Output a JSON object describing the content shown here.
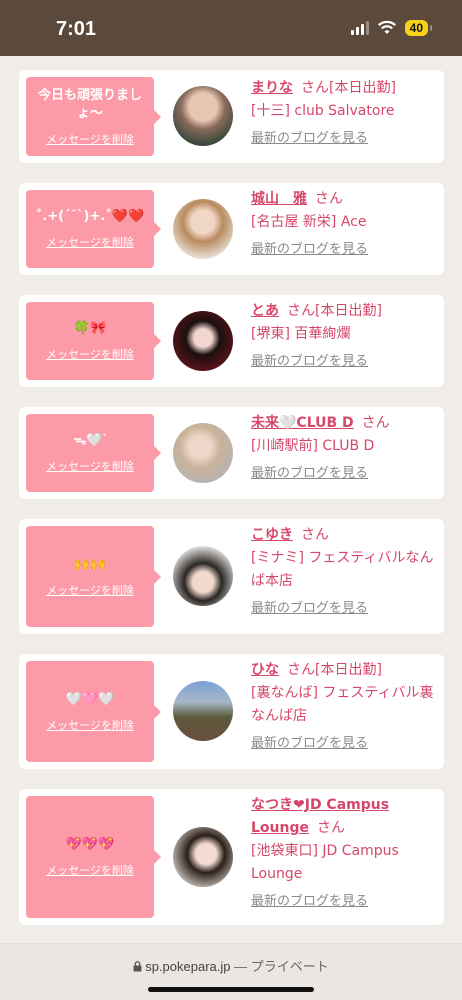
{
  "status": {
    "time": "7:01",
    "battery": "40"
  },
  "cards": [
    {
      "message": "今日も頑張りましょ〜",
      "delete_label": "メッセージを削除",
      "name": "まりな",
      "san": "さん",
      "tag": "[本日出勤]",
      "shop": "[十三] club Salvatore",
      "blog": "最新のブログを見る"
    },
    {
      "message": "˚.+(´˘`)+.˚❤️❤️",
      "delete_label": "メッセージを削除",
      "name": "城山　雅",
      "san": "さん",
      "tag": "",
      "shop": "[名古屋 新栄] Ace",
      "blog": "最新のブログを見る"
    },
    {
      "message": "🍀🎀",
      "delete_label": "メッセージを削除",
      "name": "とあ",
      "san": "さん",
      "tag": "[本日出勤]",
      "shop": "[堺東] 百華絢爛",
      "blog": "最新のブログを見る"
    },
    {
      "message": "ᯓ🤍ᐝ",
      "delete_label": "メッセージを削除",
      "name": "未来🤍CLUB D",
      "san": "さん",
      "tag": "",
      "shop": "[川崎駅前] CLUB D",
      "blog": "最新のブログを見る"
    },
    {
      "message": "🙌🙌",
      "delete_label": "メッセージを削除",
      "name": "こゆき",
      "san": "さん",
      "tag": "",
      "shop": "[ミナミ] フェスティバルなんば本店",
      "blog": "最新のブログを見る"
    },
    {
      "message": "🤍🩷🤍",
      "delete_label": "メッセージを削除",
      "name": "ひな",
      "san": "さん",
      "tag": "[本日出勤]",
      "shop": "[裏なんば] フェスティバル裏なんば店",
      "blog": "最新のブログを見る"
    },
    {
      "message": "💖💖💖",
      "delete_label": "メッセージを削除",
      "name": "なつき❤JD Campus Lounge",
      "san": "さん",
      "tag": "",
      "shop": "[池袋東口] JD Campus Lounge",
      "blog": "最新のブログを見る"
    }
  ],
  "browser": {
    "url": "sp.pokepara.jp",
    "separator": "—",
    "mode": "プライベート"
  },
  "colors": {
    "accent": "#d6476a",
    "bubble": "#fd9aa7",
    "status_bar": "#5b4a3b"
  },
  "icons": {
    "lock": "lock-icon",
    "wifi": "wifi-icon",
    "signal": "signal-icon",
    "battery": "battery-icon"
  }
}
